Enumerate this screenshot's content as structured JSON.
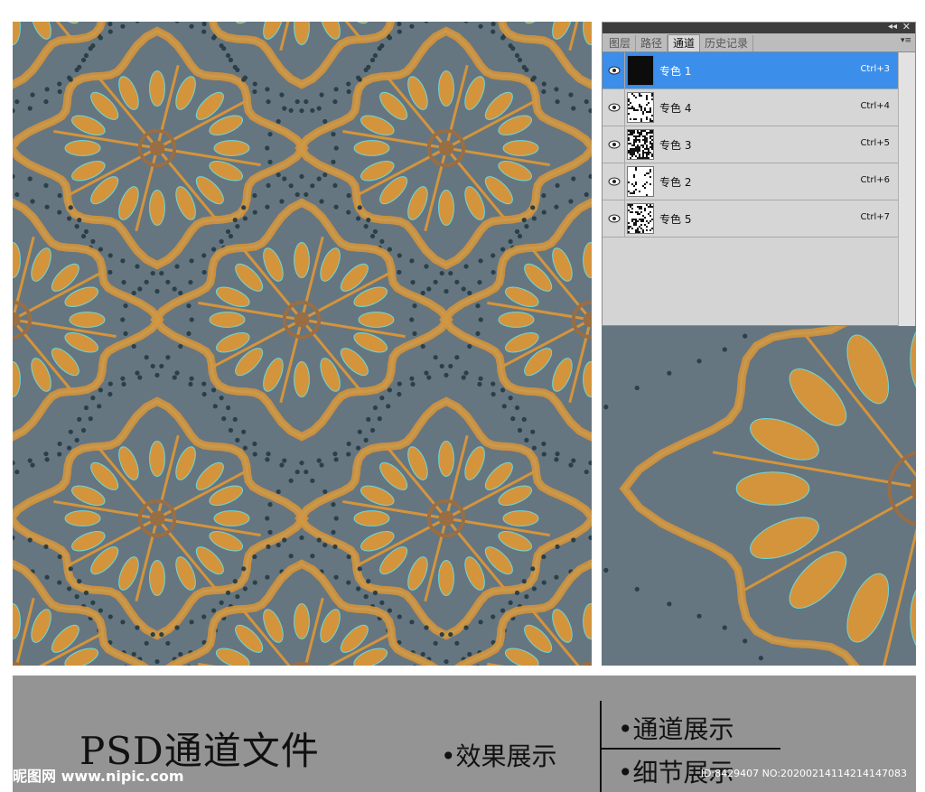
{
  "panel": {
    "tabs": [
      "图层",
      "路径",
      "通道",
      "历史记录"
    ],
    "active_tab": "通道",
    "channels": [
      {
        "name": "专色 1",
        "shortcut": "Ctrl+3",
        "selected": true,
        "thumb": "black"
      },
      {
        "name": "专色 4",
        "shortcut": "Ctrl+4",
        "selected": false,
        "thumb": "sparse"
      },
      {
        "name": "专色 3",
        "shortcut": "Ctrl+5",
        "selected": false,
        "thumb": "dense"
      },
      {
        "name": "专色 2",
        "shortcut": "Ctrl+6",
        "selected": false,
        "thumb": "light"
      },
      {
        "name": "专色 5",
        "shortcut": "Ctrl+7",
        "selected": false,
        "thumb": "pattern"
      }
    ]
  },
  "footer": {
    "title": "PSD通道文件",
    "effect_label": "•效果展示",
    "channel_label": "•通道展示",
    "detail_label": "•细节展示",
    "watermark_logo": "昵图网 www.nipic.com",
    "watermark_id": "ID:8429407 NO:20200214114214147083"
  },
  "colors": {
    "background": "#657680",
    "gold": "#d4943c",
    "gold_light": "#e0a84a",
    "cyan": "#6fd8d6",
    "bead": "#2a3f47",
    "selection": "#3b8eea"
  }
}
